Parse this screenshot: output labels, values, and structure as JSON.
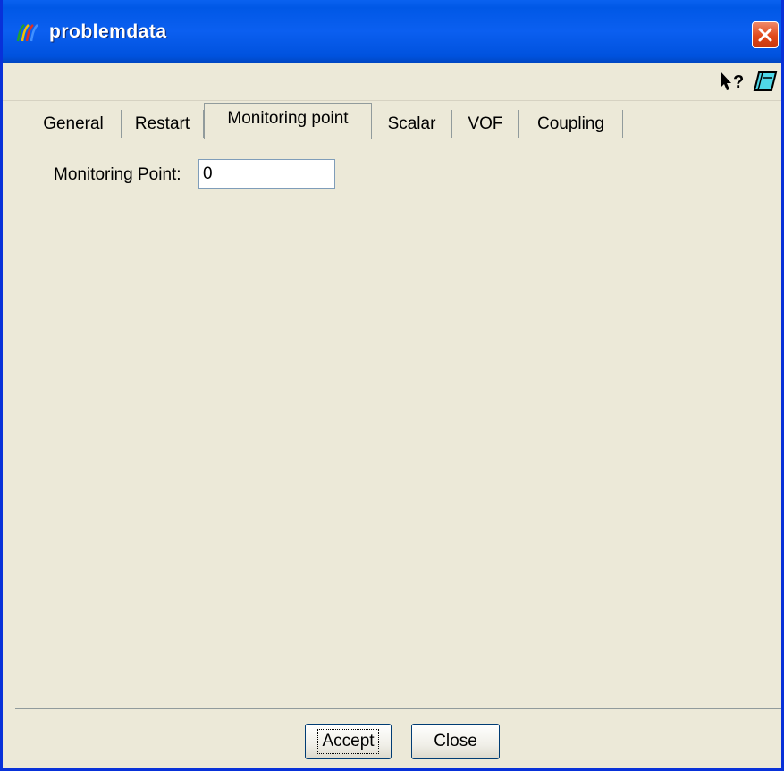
{
  "window": {
    "title": "problemdata"
  },
  "toolbar": {
    "help_icon": "whats-this-help-icon",
    "book_icon": "help-book-icon"
  },
  "tabs": [
    {
      "label": "General",
      "active": false
    },
    {
      "label": "Restart",
      "active": false
    },
    {
      "label": "Monitoring point",
      "active": true
    },
    {
      "label": "Scalar",
      "active": false
    },
    {
      "label": "VOF",
      "active": false
    },
    {
      "label": "Coupling",
      "active": false
    }
  ],
  "monitoring": {
    "label": "Monitoring Point:",
    "value": "0"
  },
  "buttons": {
    "accept": "Accept",
    "close": "Close"
  },
  "colors": {
    "titlebar": "#0058e6",
    "face": "#ece9d8",
    "close_red": "#e0481a"
  }
}
